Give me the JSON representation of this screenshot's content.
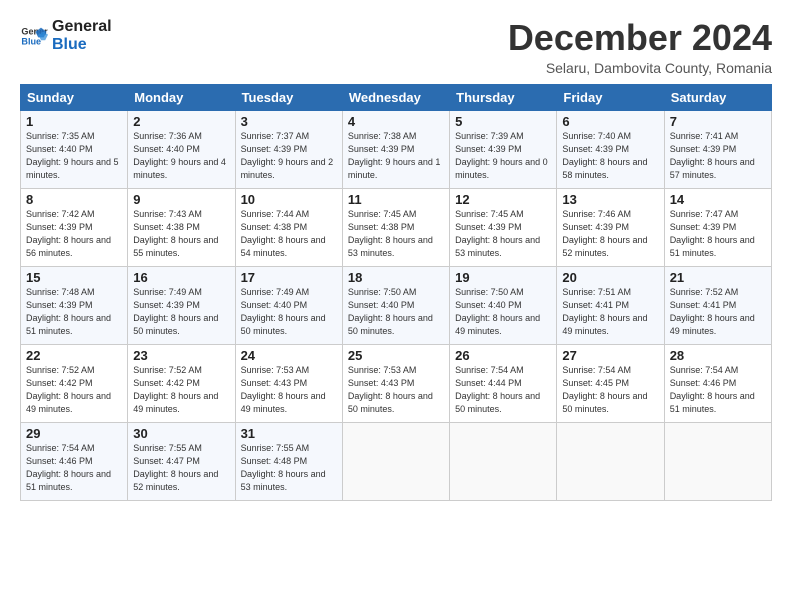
{
  "logo": {
    "line1": "General",
    "line2": "Blue"
  },
  "title": "December 2024",
  "subtitle": "Selaru, Dambovita County, Romania",
  "headers": [
    "Sunday",
    "Monday",
    "Tuesday",
    "Wednesday",
    "Thursday",
    "Friday",
    "Saturday"
  ],
  "weeks": [
    [
      {
        "day": "1",
        "sunrise": "Sunrise: 7:35 AM",
        "sunset": "Sunset: 4:40 PM",
        "daylight": "Daylight: 9 hours and 5 minutes."
      },
      {
        "day": "2",
        "sunrise": "Sunrise: 7:36 AM",
        "sunset": "Sunset: 4:40 PM",
        "daylight": "Daylight: 9 hours and 4 minutes."
      },
      {
        "day": "3",
        "sunrise": "Sunrise: 7:37 AM",
        "sunset": "Sunset: 4:39 PM",
        "daylight": "Daylight: 9 hours and 2 minutes."
      },
      {
        "day": "4",
        "sunrise": "Sunrise: 7:38 AM",
        "sunset": "Sunset: 4:39 PM",
        "daylight": "Daylight: 9 hours and 1 minute."
      },
      {
        "day": "5",
        "sunrise": "Sunrise: 7:39 AM",
        "sunset": "Sunset: 4:39 PM",
        "daylight": "Daylight: 9 hours and 0 minutes."
      },
      {
        "day": "6",
        "sunrise": "Sunrise: 7:40 AM",
        "sunset": "Sunset: 4:39 PM",
        "daylight": "Daylight: 8 hours and 58 minutes."
      },
      {
        "day": "7",
        "sunrise": "Sunrise: 7:41 AM",
        "sunset": "Sunset: 4:39 PM",
        "daylight": "Daylight: 8 hours and 57 minutes."
      }
    ],
    [
      {
        "day": "8",
        "sunrise": "Sunrise: 7:42 AM",
        "sunset": "Sunset: 4:39 PM",
        "daylight": "Daylight: 8 hours and 56 minutes."
      },
      {
        "day": "9",
        "sunrise": "Sunrise: 7:43 AM",
        "sunset": "Sunset: 4:38 PM",
        "daylight": "Daylight: 8 hours and 55 minutes."
      },
      {
        "day": "10",
        "sunrise": "Sunrise: 7:44 AM",
        "sunset": "Sunset: 4:38 PM",
        "daylight": "Daylight: 8 hours and 54 minutes."
      },
      {
        "day": "11",
        "sunrise": "Sunrise: 7:45 AM",
        "sunset": "Sunset: 4:38 PM",
        "daylight": "Daylight: 8 hours and 53 minutes."
      },
      {
        "day": "12",
        "sunrise": "Sunrise: 7:45 AM",
        "sunset": "Sunset: 4:39 PM",
        "daylight": "Daylight: 8 hours and 53 minutes."
      },
      {
        "day": "13",
        "sunrise": "Sunrise: 7:46 AM",
        "sunset": "Sunset: 4:39 PM",
        "daylight": "Daylight: 8 hours and 52 minutes."
      },
      {
        "day": "14",
        "sunrise": "Sunrise: 7:47 AM",
        "sunset": "Sunset: 4:39 PM",
        "daylight": "Daylight: 8 hours and 51 minutes."
      }
    ],
    [
      {
        "day": "15",
        "sunrise": "Sunrise: 7:48 AM",
        "sunset": "Sunset: 4:39 PM",
        "daylight": "Daylight: 8 hours and 51 minutes."
      },
      {
        "day": "16",
        "sunrise": "Sunrise: 7:49 AM",
        "sunset": "Sunset: 4:39 PM",
        "daylight": "Daylight: 8 hours and 50 minutes."
      },
      {
        "day": "17",
        "sunrise": "Sunrise: 7:49 AM",
        "sunset": "Sunset: 4:40 PM",
        "daylight": "Daylight: 8 hours and 50 minutes."
      },
      {
        "day": "18",
        "sunrise": "Sunrise: 7:50 AM",
        "sunset": "Sunset: 4:40 PM",
        "daylight": "Daylight: 8 hours and 50 minutes."
      },
      {
        "day": "19",
        "sunrise": "Sunrise: 7:50 AM",
        "sunset": "Sunset: 4:40 PM",
        "daylight": "Daylight: 8 hours and 49 minutes."
      },
      {
        "day": "20",
        "sunrise": "Sunrise: 7:51 AM",
        "sunset": "Sunset: 4:41 PM",
        "daylight": "Daylight: 8 hours and 49 minutes."
      },
      {
        "day": "21",
        "sunrise": "Sunrise: 7:52 AM",
        "sunset": "Sunset: 4:41 PM",
        "daylight": "Daylight: 8 hours and 49 minutes."
      }
    ],
    [
      {
        "day": "22",
        "sunrise": "Sunrise: 7:52 AM",
        "sunset": "Sunset: 4:42 PM",
        "daylight": "Daylight: 8 hours and 49 minutes."
      },
      {
        "day": "23",
        "sunrise": "Sunrise: 7:52 AM",
        "sunset": "Sunset: 4:42 PM",
        "daylight": "Daylight: 8 hours and 49 minutes."
      },
      {
        "day": "24",
        "sunrise": "Sunrise: 7:53 AM",
        "sunset": "Sunset: 4:43 PM",
        "daylight": "Daylight: 8 hours and 49 minutes."
      },
      {
        "day": "25",
        "sunrise": "Sunrise: 7:53 AM",
        "sunset": "Sunset: 4:43 PM",
        "daylight": "Daylight: 8 hours and 50 minutes."
      },
      {
        "day": "26",
        "sunrise": "Sunrise: 7:54 AM",
        "sunset": "Sunset: 4:44 PM",
        "daylight": "Daylight: 8 hours and 50 minutes."
      },
      {
        "day": "27",
        "sunrise": "Sunrise: 7:54 AM",
        "sunset": "Sunset: 4:45 PM",
        "daylight": "Daylight: 8 hours and 50 minutes."
      },
      {
        "day": "28",
        "sunrise": "Sunrise: 7:54 AM",
        "sunset": "Sunset: 4:46 PM",
        "daylight": "Daylight: 8 hours and 51 minutes."
      }
    ],
    [
      {
        "day": "29",
        "sunrise": "Sunrise: 7:54 AM",
        "sunset": "Sunset: 4:46 PM",
        "daylight": "Daylight: 8 hours and 51 minutes."
      },
      {
        "day": "30",
        "sunrise": "Sunrise: 7:55 AM",
        "sunset": "Sunset: 4:47 PM",
        "daylight": "Daylight: 8 hours and 52 minutes."
      },
      {
        "day": "31",
        "sunrise": "Sunrise: 7:55 AM",
        "sunset": "Sunset: 4:48 PM",
        "daylight": "Daylight: 8 hours and 53 minutes."
      },
      null,
      null,
      null,
      null
    ]
  ]
}
